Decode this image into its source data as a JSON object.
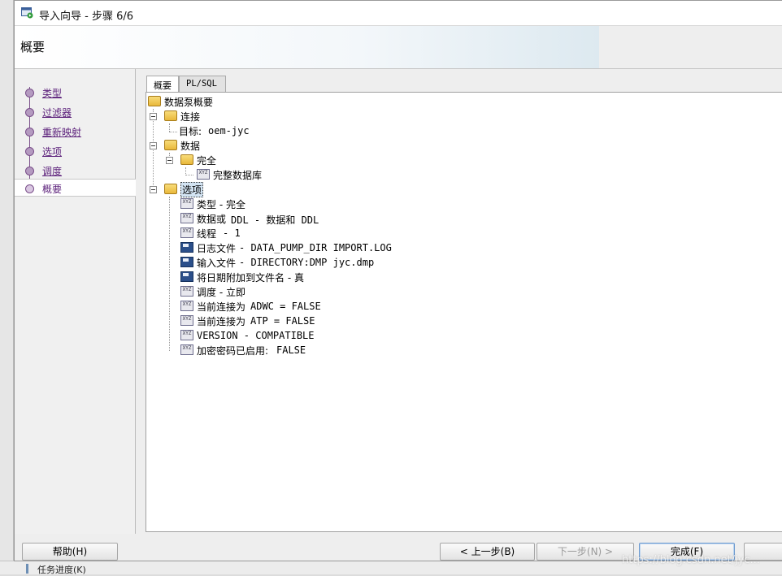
{
  "window": {
    "title": "导入向导 - 步骤 6/6"
  },
  "header": {
    "title": "概要"
  },
  "steps": [
    {
      "label": "类型"
    },
    {
      "label": "过滤器"
    },
    {
      "label": "重新映射"
    },
    {
      "label": "选项"
    },
    {
      "label": "调度"
    },
    {
      "label": "概要"
    }
  ],
  "tabs": [
    {
      "label": "概要"
    },
    {
      "label": "PL/SQL"
    }
  ],
  "tree": {
    "root": "数据泵概要",
    "connection": "连接",
    "target_label": "目标:",
    "target_value": "oem-jyc",
    "data": "数据",
    "complete": "完全",
    "full_db": "完整数据库",
    "options": "选项",
    "opt_type_cn": "类型 - 完全",
    "opt_data_a": "数据或",
    "opt_data_b": "DDL - 数据和 DDL",
    "opt_threads_a": "线程",
    "opt_threads_b": "- 1",
    "opt_log_a": "日志文件",
    "opt_log_b": "- DATA_PUMP_DIR IMPORT.LOG",
    "opt_input_a": "输入文件",
    "opt_input_b": "- DIRECTORY:DMP jyc.dmp",
    "opt_date": "将日期附加到文件名 - 真",
    "opt_sched": "调度 - 立即",
    "opt_adwc_a": "当前连接为",
    "opt_adwc_b": "ADWC = FALSE",
    "opt_atp_a": "当前连接为",
    "opt_atp_b": "ATP = FALSE",
    "opt_version": "VERSION - COMPATIBLE",
    "opt_enc_a": "加密密码已启用:",
    "opt_enc_b": "FALSE"
  },
  "buttons": {
    "help": "帮助(H)",
    "back": "< 上一步(B)",
    "next": "下一步(N) >",
    "finish": "完成(F)"
  },
  "background": {
    "task_progress": "任务进度(K)"
  },
  "watermark": "https://blog.csdn.net/jyc..."
}
